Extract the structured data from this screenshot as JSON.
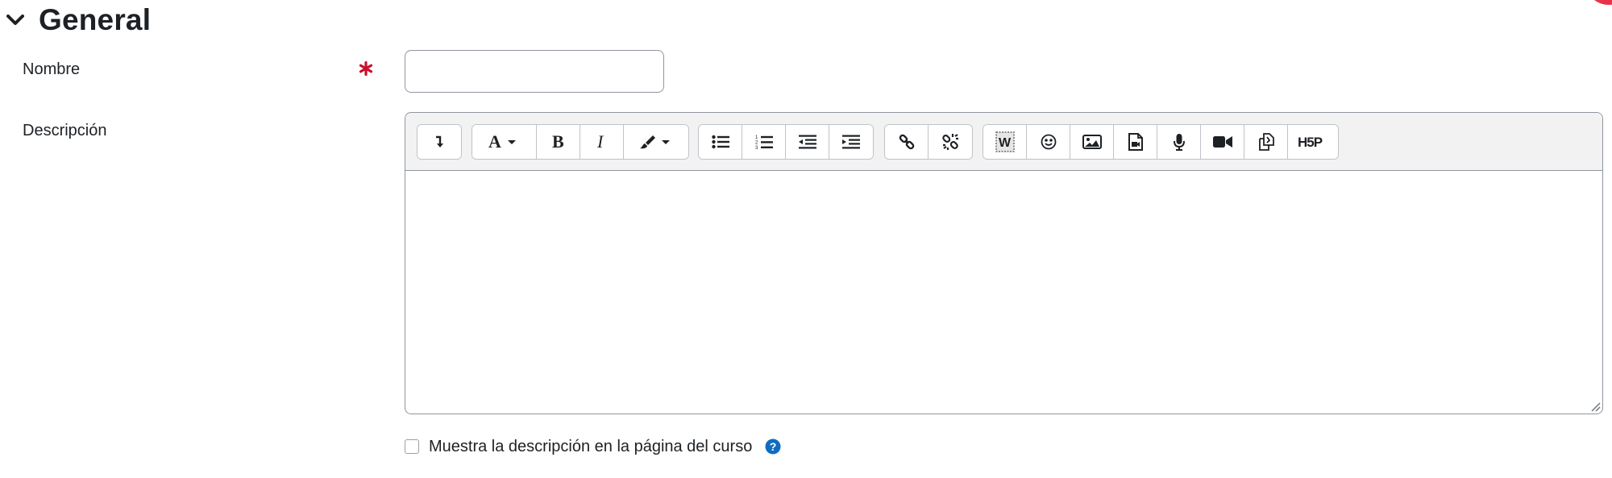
{
  "section": {
    "title": "General"
  },
  "fields": {
    "name_label": "Nombre",
    "name_value": "",
    "description_label": "Descripción"
  },
  "checkbox": {
    "label": "Muestra la descripción en la página del curso",
    "checked": false
  },
  "toolbar": {
    "groups": [
      [
        "show-more-icon"
      ],
      [
        "font-style-icon",
        "bold-icon",
        "italic-icon",
        "text-color-icon"
      ],
      [
        "unordered-list-icon",
        "ordered-list-icon",
        "outdent-icon",
        "indent-icon"
      ],
      [
        "link-icon",
        "unlink-icon"
      ],
      [
        "paste-from-word-icon",
        "emoticon-icon",
        "image-icon",
        "media-icon",
        "record-audio-icon",
        "record-video-icon",
        "manage-files-icon",
        "h5p-icon"
      ]
    ],
    "h5p_label": "H5P"
  },
  "colors": {
    "required": "#c8102e",
    "help": "#0f6cbf",
    "accent_blob": "#e8334a"
  }
}
